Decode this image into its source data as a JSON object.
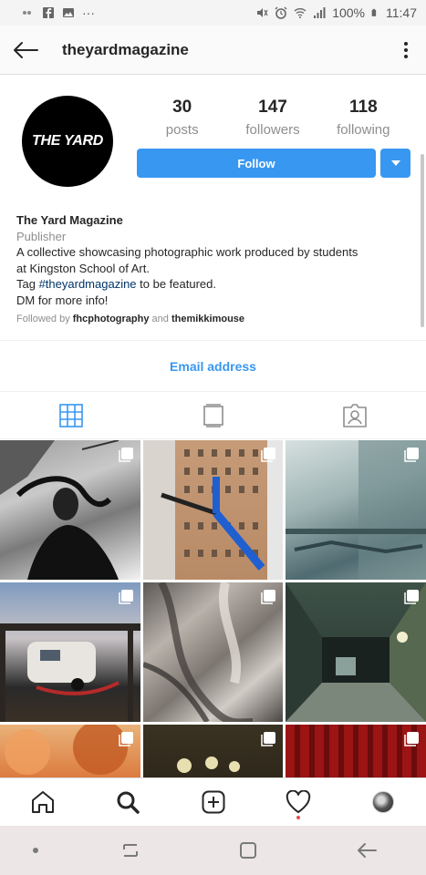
{
  "status_bar": {
    "battery": "100%",
    "time": "11:47",
    "left_icons": [
      "notification-dots",
      "facebook-icon",
      "gallery-icon",
      "more-dots"
    ],
    "right_icons": [
      "mute-icon",
      "alarm-icon",
      "wifi-icon",
      "signal-icon",
      "battery-icon"
    ]
  },
  "header": {
    "username": "theyardmagazine",
    "back_icon": "back-arrow-icon",
    "menu_icon": "vertical-dots-icon"
  },
  "profile": {
    "avatar_text": "THE YARD",
    "stats": [
      {
        "value": "30",
        "label": "posts"
      },
      {
        "value": "147",
        "label": "followers"
      },
      {
        "value": "118",
        "label": "following"
      }
    ],
    "follow_label": "Follow",
    "bio": {
      "name": "The Yard Magazine",
      "category": "Publisher",
      "line1": "A collective showcasing photographic work produced by students",
      "line2": "at Kingston School of Art.",
      "line3_prefix": "Tag ",
      "hashtag": "#theyardmagazine",
      "line3_suffix": " to be featured.",
      "line4": "DM for more info!",
      "followed_by_prefix": "Followed by ",
      "followed_by_1": "fhcphotography",
      "followed_by_and": " and ",
      "followed_by_2": "themikkimouse"
    },
    "email_label": "Email address"
  },
  "tabs": [
    {
      "name": "grid",
      "icon": "grid-icon",
      "active": true
    },
    {
      "name": "feed",
      "icon": "feed-icon",
      "active": false
    },
    {
      "name": "tagged",
      "icon": "tagged-icon",
      "active": false
    }
  ],
  "grid_posts": [
    {
      "desc": "bw-portrait",
      "multi": true
    },
    {
      "desc": "building-crane",
      "multi": true
    },
    {
      "desc": "window-reflection",
      "multi": true
    },
    {
      "desc": "caravan-dusk",
      "multi": true
    },
    {
      "desc": "fabric-drape",
      "multi": true
    },
    {
      "desc": "corridor",
      "multi": true
    },
    {
      "desc": "orange-trees",
      "multi": true
    },
    {
      "desc": "dark-scene",
      "multi": true
    },
    {
      "desc": "red-curtain",
      "multi": true
    }
  ],
  "bottom_nav": [
    "home-icon",
    "search-icon",
    "add-post-icon",
    "activity-heart-icon",
    "profile-avatar"
  ],
  "colors": {
    "accent": "#3897f0",
    "text": "#262626",
    "secondary": "#8e8e8e",
    "hashtag": "#003569",
    "notification": "#ed4956"
  }
}
